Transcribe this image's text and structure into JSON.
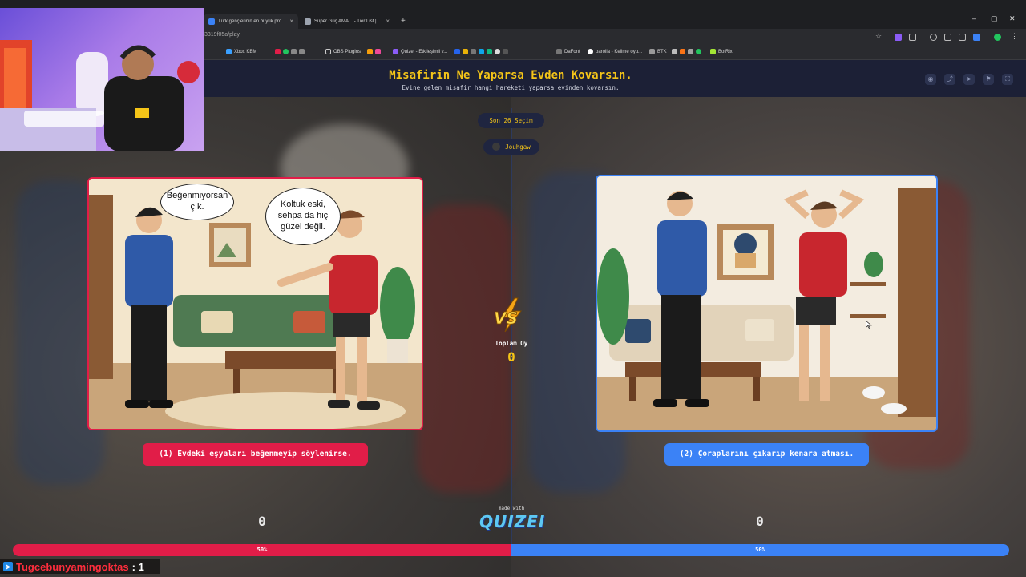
{
  "browser": {
    "tabs": [
      {
        "label": "Türk gençlerinin en büyük prob"
      },
      {
        "label": "Süper Güç AMA... - Tier List | Kn"
      }
    ],
    "new_tab": "+",
    "url": "3319f05a/play",
    "bookmarks": [
      {
        "label": "Xbox KBM",
        "color": "#3aa0ff"
      },
      {
        "label": "OBS Plugins",
        "color": "#aaaaaa"
      },
      {
        "label": "Quizei - Etkileşimli v...",
        "color": "#8b5cf6"
      },
      {
        "label": "DaFont",
        "color": "#777777"
      },
      {
        "label": "parolla - Kelime oyu...",
        "color": "#ffffff"
      },
      {
        "label": "BTK",
        "color": "#999999"
      },
      {
        "label": "BotRix",
        "color": "#a3e635"
      }
    ],
    "window_controls": [
      "–",
      "▢",
      "✕"
    ]
  },
  "header": {
    "title": "Misafirin Ne Yaparsa Evden Kovarsın.",
    "subtitle": "Evine gelen misafir hangi hareketi yaparsa evinden kovarsın.",
    "icons": [
      "eye-icon",
      "share-icon",
      "send-icon",
      "flag-icon",
      "fullscreen-icon"
    ]
  },
  "status": {
    "selection_label": "Son 26 Seçim",
    "user_name": "Jouhgaw"
  },
  "left": {
    "bubble1": "Beğenmiyorsan çık.",
    "bubble2": "Koltuk eski, sehpa da hiç güzel değil.",
    "choice_label": "(1) Evdeki eşyaları beğenmeyip söylenirse.",
    "votes": "0",
    "percent": "50%",
    "color": "#e11d48"
  },
  "right": {
    "choice_label": "(2) Çoraplarını çıkarıp kenara atması.",
    "votes": "0",
    "percent": "50%",
    "color": "#3b82f6"
  },
  "center": {
    "vs_label": "VS",
    "total_label": "Toplam Oy",
    "total_value": "0",
    "made_with": "made with",
    "brand": "QUIZEI"
  },
  "chat": {
    "user": "Tugcebunyamingoktas",
    "message": ": 1"
  }
}
